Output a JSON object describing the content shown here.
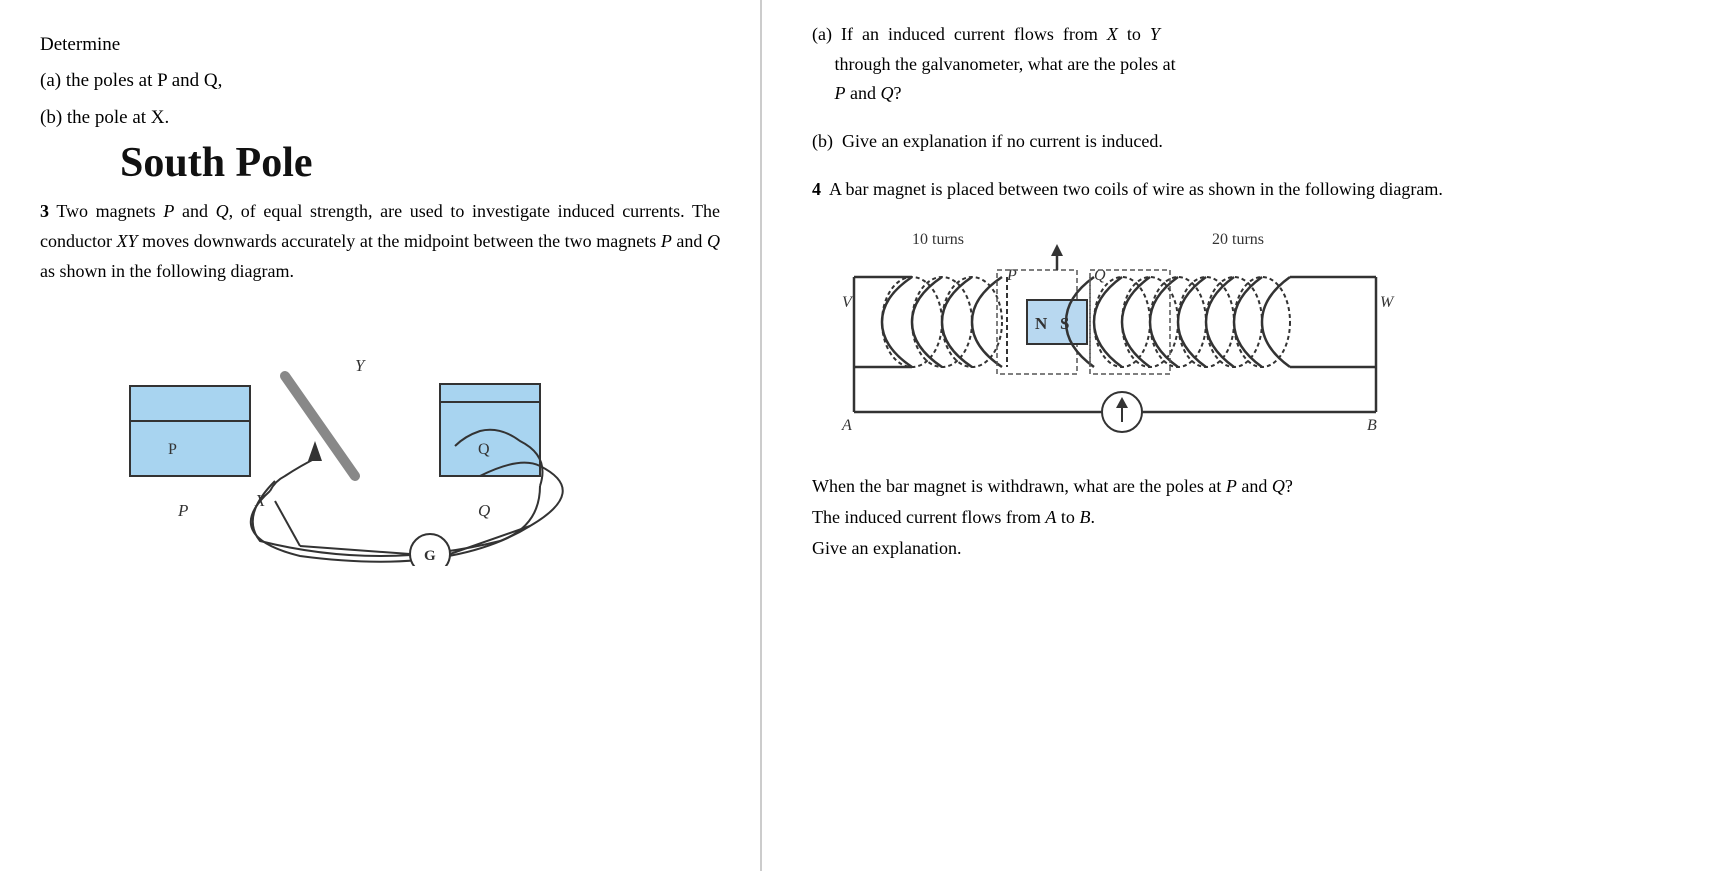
{
  "left": {
    "determine_label": "Determine",
    "item_a": "(a)  the poles at P and Q,",
    "item_b": "(b)  the pole at X.",
    "handwritten": "South Pole",
    "problem3_number": "3",
    "problem3_text": "Two magnets P and Q, of equal strength, are used to investigate induced currents. The conductor XY moves downwards accurately at the midpoint between the two magnets P and Q as shown in the following diagram."
  },
  "right": {
    "qa_label": "(a)",
    "qa_text": "If  an  induced  current  flows  from  X  to  Y through the galvanometer, what are the poles at P and Q?",
    "qb_label": "(b)",
    "qb_text": "Give an explanation if no current is induced.",
    "q4_number": "4",
    "q4_text": "A bar magnet is placed between two coils of wire as shown in the following diagram.",
    "coil_left_turns": "10 turns",
    "coil_right_turns": "20 turns",
    "label_v": "V",
    "label_p": "P",
    "label_q": "Q",
    "label_w": "W",
    "label_n": "N",
    "label_s": "S",
    "label_a": "A",
    "label_b": "B",
    "answer1": "When the bar magnet is withdrawn, what are the poles at P and Q?",
    "answer2": "The induced current flows from A to B.",
    "answer3": "Give an explanation."
  }
}
